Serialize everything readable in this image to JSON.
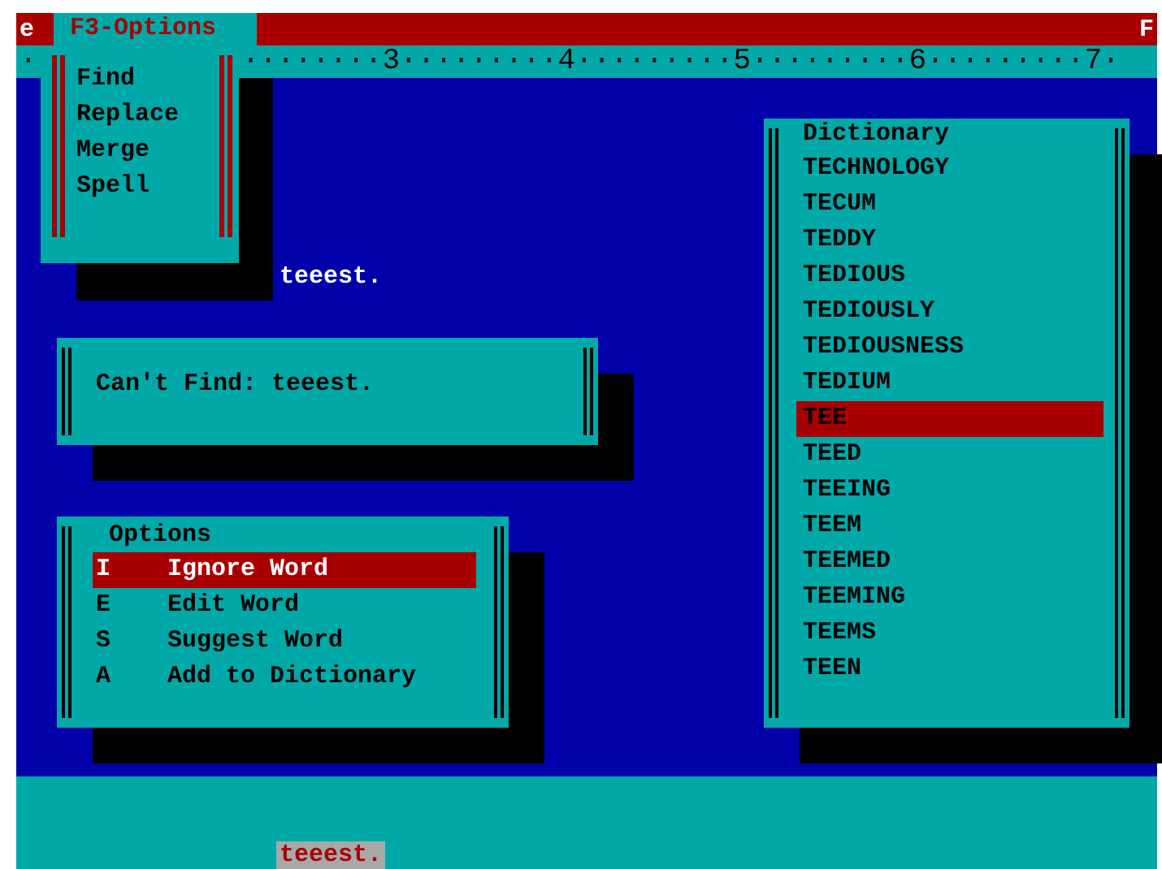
{
  "menu_bar": {
    "items": [
      {
        "label": "e",
        "selected": false
      },
      {
        "label": "F3-Options",
        "selected": true
      },
      {
        "label": "F",
        "selected": false
      }
    ]
  },
  "ruler": {
    "left": "·",
    "right": "········3·········4·········5·········6·········7·"
  },
  "dropdown": {
    "items": [
      {
        "label": "Find",
        "selected": false
      },
      {
        "label": "Replace",
        "selected": false
      },
      {
        "label": "Merge",
        "selected": false
      },
      {
        "label": "Spell",
        "selected": false
      }
    ]
  },
  "document_word": "teeest.",
  "message_box": {
    "text": "Can't Find: teeest."
  },
  "options_box": {
    "title": "Options",
    "items": [
      {
        "key": "I",
        "label": "Ignore Word",
        "selected": true
      },
      {
        "key": "E",
        "label": "Edit Word",
        "selected": false
      },
      {
        "key": "S",
        "label": "Suggest Word",
        "selected": false
      },
      {
        "key": "A",
        "label": "Add to Dictionary",
        "selected": false
      }
    ]
  },
  "dictionary_box": {
    "title": "Dictionary",
    "words": [
      {
        "word": "TECHNOLOGY",
        "selected": false
      },
      {
        "word": "TECUM",
        "selected": false
      },
      {
        "word": "TEDDY",
        "selected": false
      },
      {
        "word": "TEDIOUS",
        "selected": false
      },
      {
        "word": "TEDIOUSLY",
        "selected": false
      },
      {
        "word": "TEDIOUSNESS",
        "selected": false
      },
      {
        "word": "TEDIUM",
        "selected": false
      },
      {
        "word": "TEE",
        "selected": true
      },
      {
        "word": "TEED",
        "selected": false
      },
      {
        "word": "TEEING",
        "selected": false
      },
      {
        "word": "TEEM",
        "selected": false
      },
      {
        "word": "TEEMED",
        "selected": false
      },
      {
        "word": "TEEMING",
        "selected": false
      },
      {
        "word": "TEEMS",
        "selected": false
      },
      {
        "word": "TEEN",
        "selected": false
      }
    ]
  },
  "status_panel": {
    "word": "teeest."
  }
}
